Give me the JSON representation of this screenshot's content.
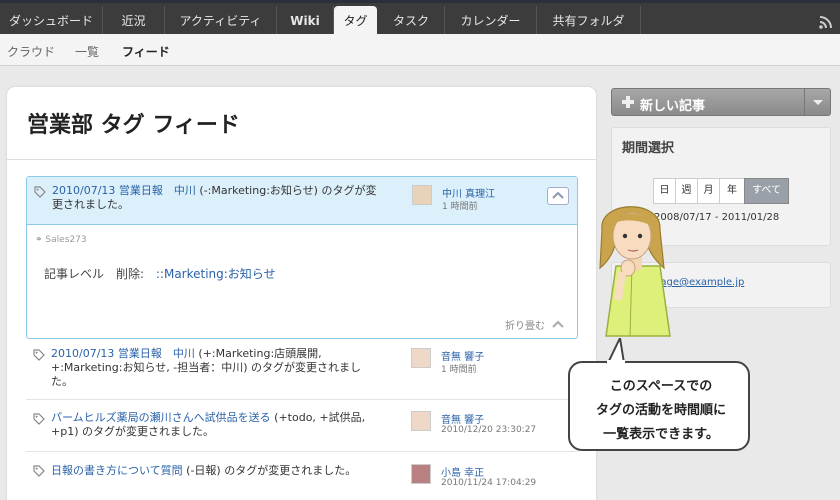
{
  "nav": {
    "tabs": [
      "ダッシュボード",
      "近況",
      "アクティビティ",
      "Wiki",
      "タグ",
      "タスク",
      "カレンダー",
      "共有フォルダ"
    ],
    "active_tab": "タグ"
  },
  "subnav": {
    "items": [
      "クラウド",
      "一覧",
      "フィード"
    ],
    "active": "フィード"
  },
  "page": {
    "title": "営業部 タグ フィード"
  },
  "expanded_entry": {
    "line1_prefix": "2010/07/13 営業日報　中川",
    "line1_suffix": " (-:Marketing:お知らせ) のタグが変",
    "line2": "更されました。",
    "user_name": "中川 真理江",
    "user_time": "1 時間前",
    "tag_label": "Sales273",
    "body_label": "記事レベル　削除:",
    "body_link": "::Marketing:お知らせ",
    "fold_label": "折り畳む"
  },
  "entries": [
    {
      "line1_prefix": "2010/07/13 営業日報　中川",
      "line1_suffix": " (+:Marketing:店頭展開,",
      "line2": "+:Marketing:お知らせ, -担当者：中川) のタグが変更されまし",
      "line3": "た。",
      "user_name": "音無 響子",
      "user_time": "1 時間前"
    },
    {
      "line1_prefix": "パームヒルズ薬局の瀬川さんへ試供品を送る",
      "line1_suffix": " (+todo, +試供品,",
      "line2": "+p1) のタグが変更されました。",
      "user_name": "音無 響子",
      "user_time": "2010/12/20 23:30:27"
    },
    {
      "line1_prefix": "日報の書き方について質問",
      "line1_suffix": " (-日報) のタグが変更されました。",
      "user_name": "小島 幸正",
      "user_time": "2010/11/24 17:04:29"
    }
  ],
  "sidebar": {
    "new_post_label": "新しい記事",
    "period_title": "期間選択",
    "periods": [
      "日",
      "週",
      "月",
      "年",
      "すべて"
    ],
    "active_period": "すべて",
    "date_range": "2008/07/17 - 2011/01/28",
    "email": "page@example.jp"
  },
  "bubble": {
    "lines": [
      "このスペースでの",
      "タグの活動を時間順に",
      "一覧表示できます。"
    ]
  },
  "colors": {
    "link": "#2a62a8",
    "highlight": "#dcf0fb",
    "nav_bg": "#3c3c3c"
  }
}
